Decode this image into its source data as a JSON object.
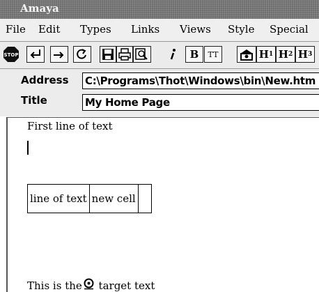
{
  "window": {
    "title": "Amaya"
  },
  "menu": [
    "File",
    "Edit",
    "Types",
    "Links",
    "Views",
    "Style",
    "Special"
  ],
  "toolbar": {
    "bold": "B",
    "teletype": "TT",
    "h1": "H",
    "h1_sub": "1",
    "h2": "H",
    "h2_sub": "2",
    "h3": "H",
    "h3_sub": "3"
  },
  "address": {
    "label": "Address",
    "value": "C:\\Programs\\Thot\\Windows\\bin\\New.htm"
  },
  "title_field": {
    "label": "Title",
    "value": "My Home Page"
  },
  "document": {
    "line1": "First line of text",
    "table_cells": [
      "line of text",
      "new cell",
      ""
    ],
    "target_prefix": "This is the",
    "target_suffix": "target text"
  },
  "icons": [
    "stop-icon",
    "back-icon",
    "forward-icon",
    "reload-icon",
    "save-icon",
    "print-icon",
    "find-icon",
    "italic-icon",
    "bold-icon",
    "teletype-icon",
    "image-icon",
    "target-icon"
  ]
}
